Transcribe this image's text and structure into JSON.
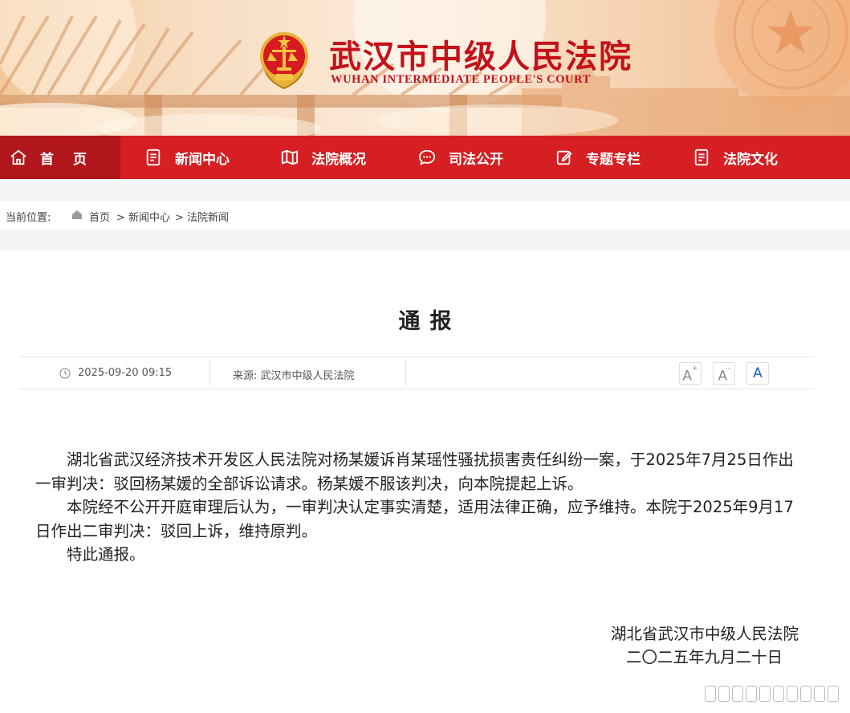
{
  "header": {
    "court_name_cn": "武汉市中级人民法院",
    "court_name_en": "WUHAN INTERMEDIATE PEOPLE'S COURT"
  },
  "nav": {
    "items": [
      {
        "label": "首页",
        "icon": "home-icon"
      },
      {
        "label": "新闻中心",
        "icon": "document-icon"
      },
      {
        "label": "法院概况",
        "icon": "map-icon"
      },
      {
        "label": "司法公开",
        "icon": "chat-icon"
      },
      {
        "label": "专题专栏",
        "icon": "edit-icon"
      },
      {
        "label": "法院文化",
        "icon": "document-icon"
      }
    ]
  },
  "breadcrumb": {
    "prefix": "当前位置:",
    "items": [
      "首页",
      "> 新闻中心",
      "> 法院新闻"
    ]
  },
  "article": {
    "title": "通报",
    "date": "2025-09-20 09:15",
    "source": "来源: 武汉市中级人民法院",
    "font_buttons": [
      "A",
      "A",
      "A"
    ],
    "paragraphs": [
      "湖北省武汉经济技术开发区人民法院对杨某媛诉肖某瑶性骚扰损害责任纠纷一案，于2025年7月25日作出一审判决：驳回杨某媛的全部诉讼请求。杨某媛不服该判决，向本院提起上诉。",
      "本院经不公开开庭审理后认为，一审判决认定事实清楚，适用法律正确，应予维持。本院于2025年9月17日作出二审判决：驳回上诉，维持原判。",
      "特此通报。"
    ],
    "signature": "湖北省武汉市中级人民法院",
    "sign_date": "二〇二五年九月二十日"
  },
  "colors": {
    "brand_red": "#d51f23",
    "brand_red_dark": "#b0161b",
    "title_red": "#c4111a",
    "font_active": "#1d62c4"
  }
}
